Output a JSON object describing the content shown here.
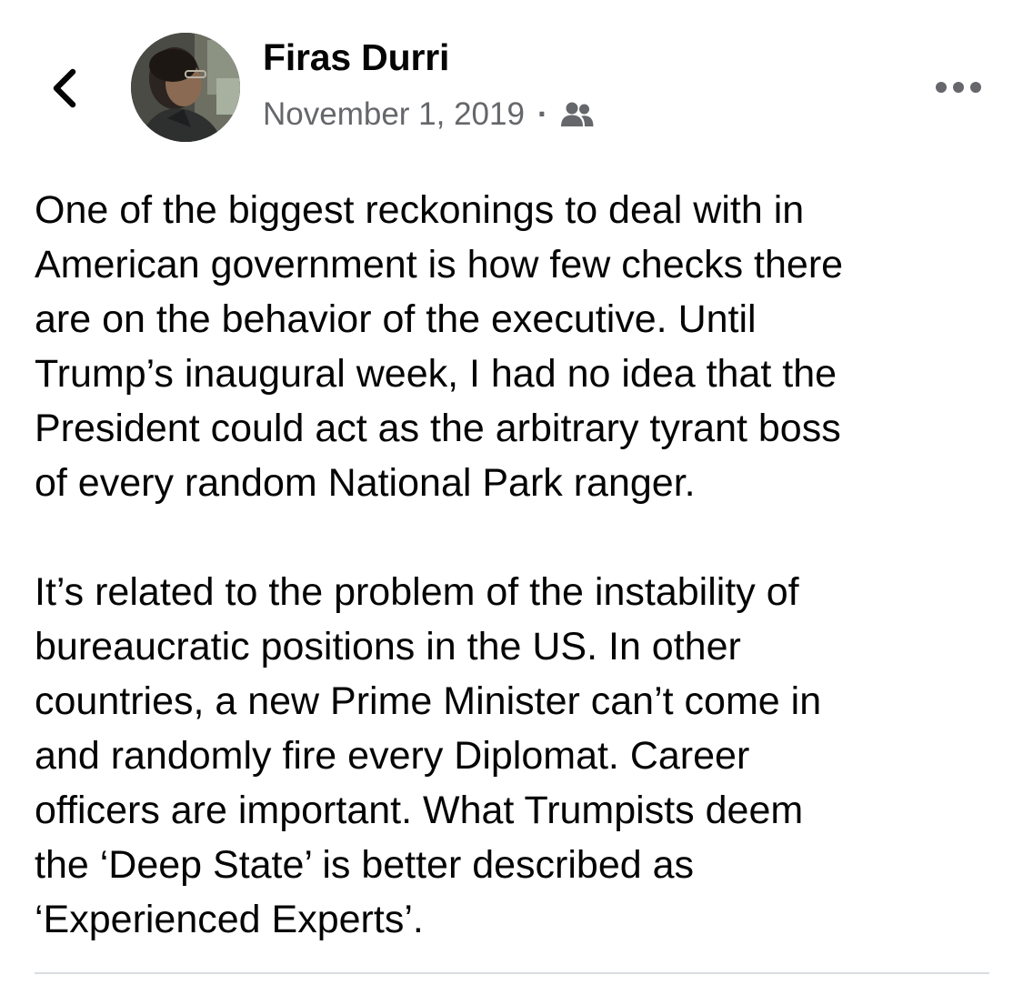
{
  "header": {
    "back_icon": "chevron-left-icon",
    "author_name": "Firas Durri",
    "date": "November 1, 2019",
    "separator": "·",
    "audience_icon": "friends-icon",
    "more_icon": "ellipsis-horizontal-icon"
  },
  "post": {
    "paragraphs": [
      "One of the biggest reckonings to deal with in\nAmerican government is how few checks there\nare on the behavior of the executive. Until\nTrump’s inaugural week, I had no idea that the\nPresident could act as the arbitrary tyrant boss\nof every random National Park ranger.",
      "It’s related to the problem of the instability of\nbureaucratic positions in the US. In other\ncountries, a new Prime Minister can’t come in\nand randomly fire every Diplomat. Career\nofficers are important. What Trumpists deem\nthe ‘Deep State’ is better described as\n‘Experienced Experts’."
    ]
  },
  "colors": {
    "text": "#050505",
    "secondary_text": "#65676b",
    "divider": "#dadde1",
    "background": "#ffffff"
  }
}
